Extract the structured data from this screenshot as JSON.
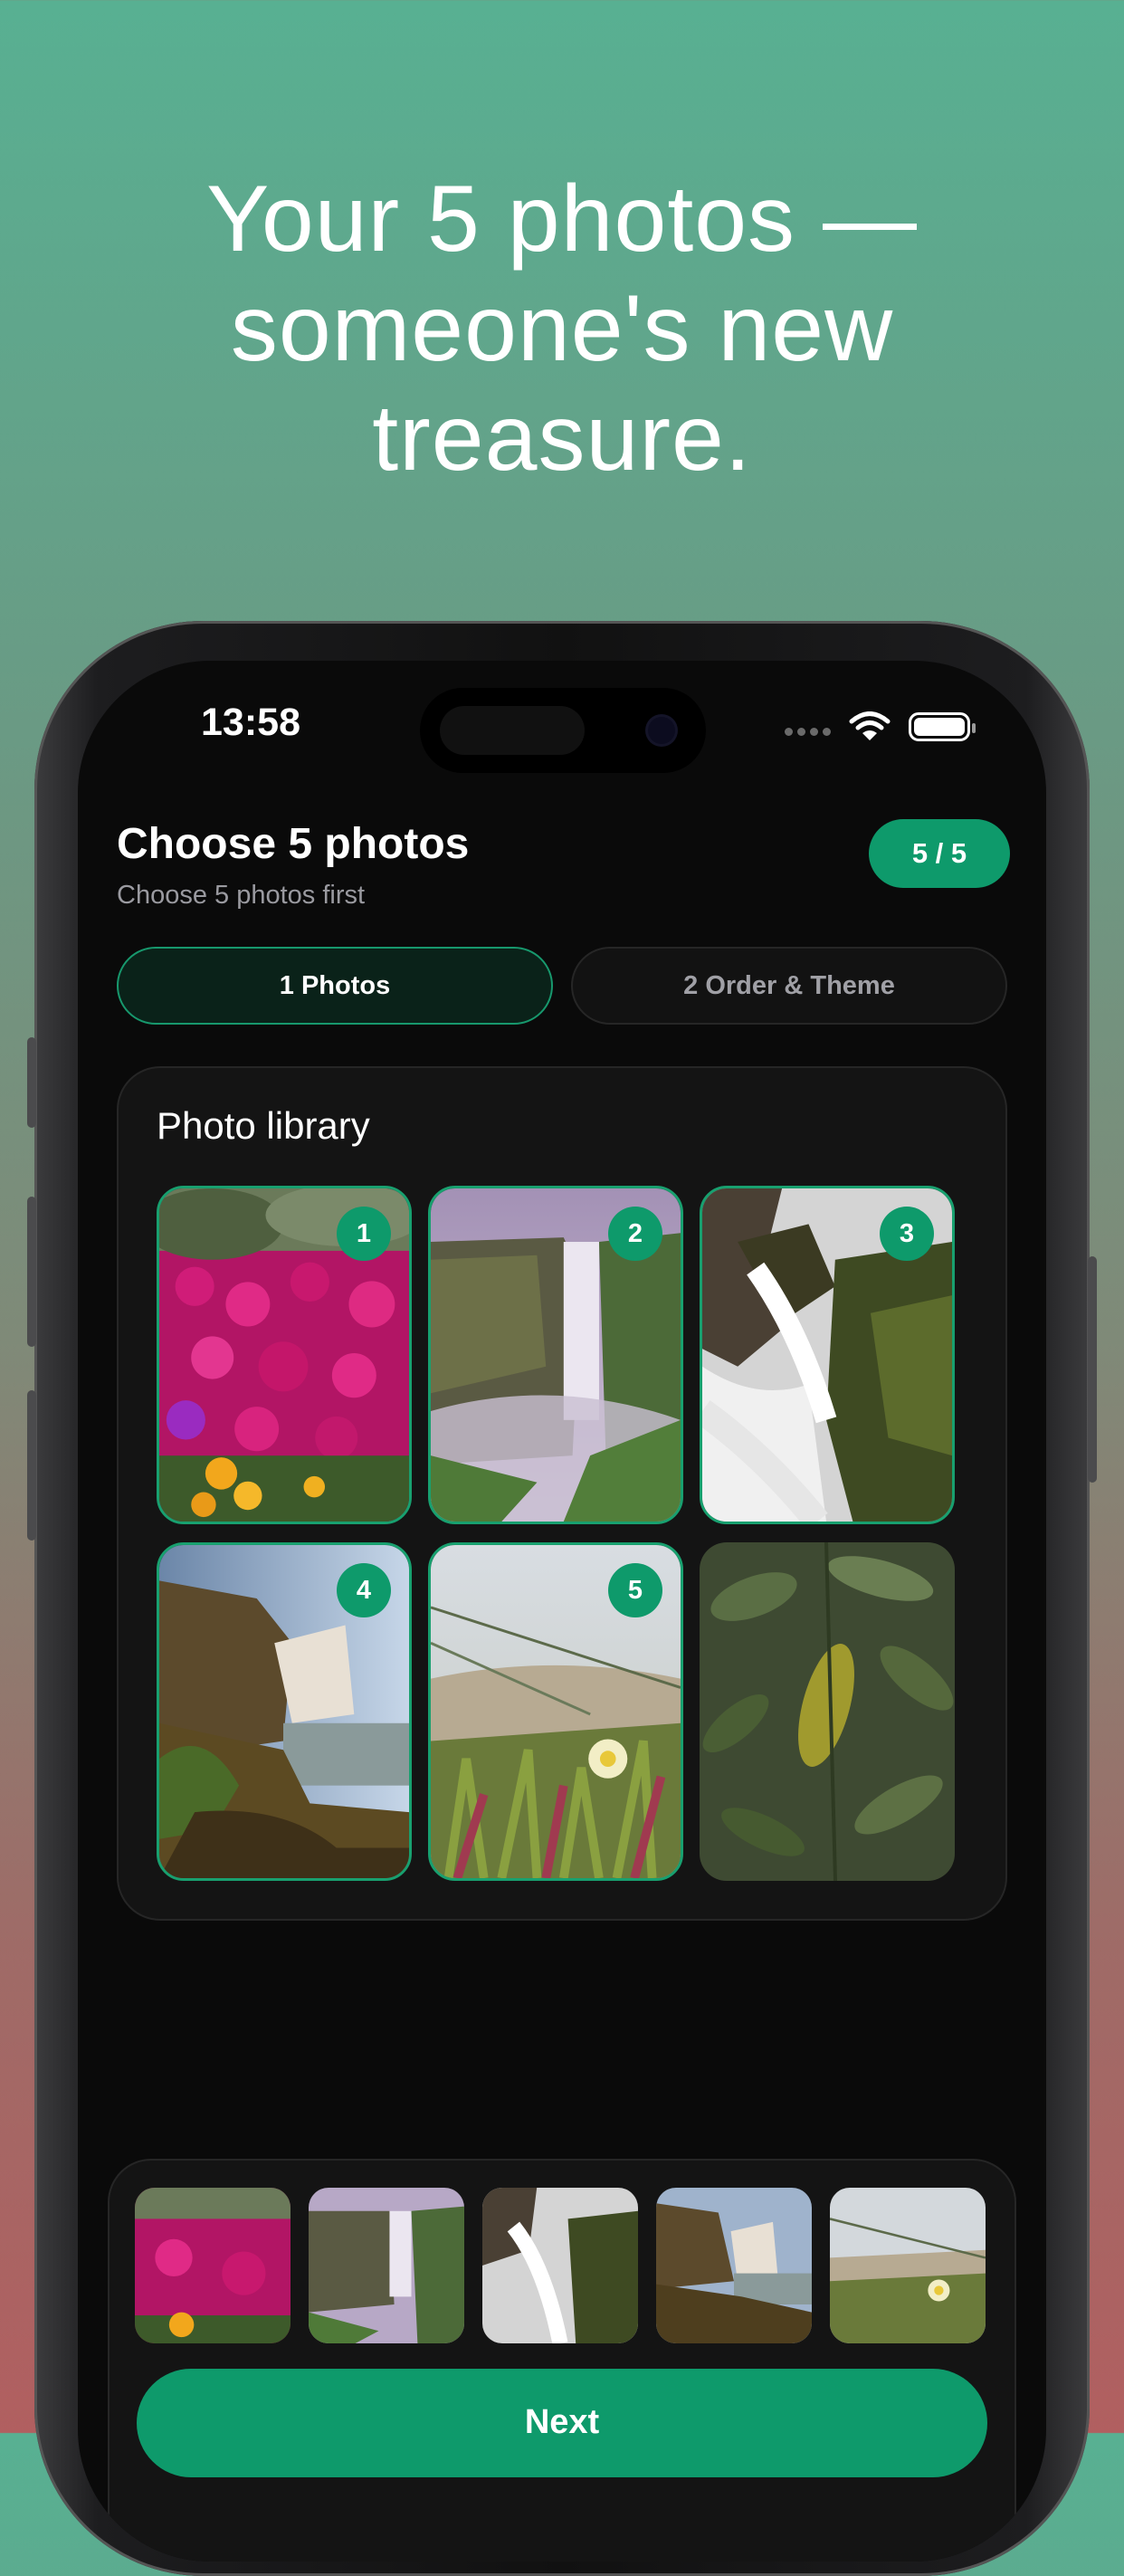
{
  "headline": {
    "line1": "Your 5 photos —",
    "line2": "someone's new",
    "line3": "treasure."
  },
  "status_bar": {
    "time": "13:58",
    "icons": [
      "signal-dots-icon",
      "wifi-icon",
      "battery-icon"
    ]
  },
  "header": {
    "title": "Choose 5 photos",
    "subtitle": "Choose 5 photos first",
    "counter": "5 / 5"
  },
  "tabs": [
    {
      "label": "1 Photos",
      "active": true
    },
    {
      "label": "2 Order & Theme",
      "active": false
    }
  ],
  "library": {
    "title": "Photo library",
    "photos": [
      {
        "subject": "pink-flowers",
        "badge": "1",
        "selected": true
      },
      {
        "subject": "waterfall-misty",
        "badge": "2",
        "selected": true
      },
      {
        "subject": "rocky-cascade",
        "badge": "3",
        "selected": true
      },
      {
        "subject": "waterfall-cliff",
        "badge": "4",
        "selected": true
      },
      {
        "subject": "coastal-flower",
        "badge": "5",
        "selected": true
      },
      {
        "subject": "green-leaves",
        "badge": "",
        "selected": false
      }
    ]
  },
  "tray": {
    "thumbnails": [
      "pink-flowers",
      "waterfall-misty",
      "rocky-cascade",
      "waterfall-cliff",
      "coastal-flower"
    ],
    "next_label": "Next"
  },
  "colors": {
    "accent": "#0e9a6b",
    "screen_background": "#0a0a0a",
    "card_background": "#141414"
  }
}
